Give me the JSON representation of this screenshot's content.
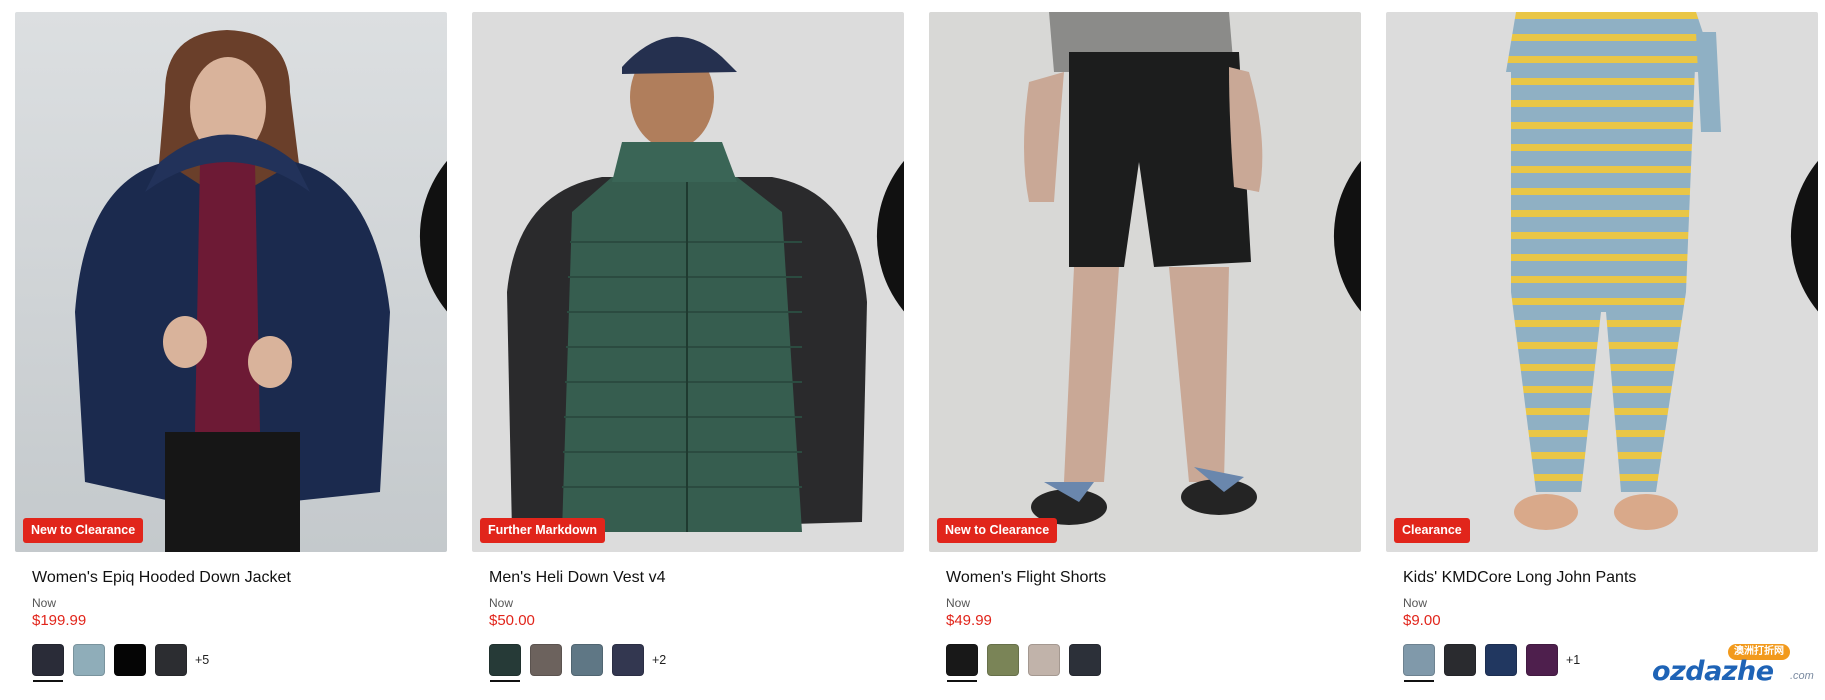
{
  "products": [
    {
      "title": "Women's Epiq Hooded Down Jacket",
      "badge": "New to Clearance",
      "now_label": "Now",
      "price": "$199.99",
      "swatches": [
        "#2a2c38",
        "#8fadb9",
        "#050505",
        "#2c2d31"
      ],
      "more": "+5",
      "wishlist_icon": "heart-outline-icon"
    },
    {
      "title": "Men's Heli Down Vest v4",
      "badge": "Further Markdown",
      "now_label": "Now",
      "price": "$50.00",
      "swatches": [
        "#263a37",
        "#6c625d",
        "#5f7785",
        "#333750"
      ],
      "more": "+2",
      "wishlist_icon": "heart-outline-icon"
    },
    {
      "title": "Women's Flight Shorts",
      "badge": "New to Clearance",
      "now_label": "Now",
      "price": "$49.99",
      "swatches": [
        "#181818",
        "#7a8457",
        "#c1b3aa",
        "#2c3039"
      ],
      "more": "",
      "wishlist_icon": "heart-outline-icon"
    },
    {
      "title": "Kids' KMDCore Long John Pants",
      "badge": "Clearance",
      "now_label": "Now",
      "price": "$9.00",
      "swatches": [
        "#8099aa",
        "#2a2b2f",
        "#213760",
        "#4e1f4d"
      ],
      "more": "+1",
      "wishlist_icon": "heart-outline-icon"
    }
  ],
  "watermark": {
    "text": "ozdazhe",
    "suffix": ".com",
    "tag": "澳洲打折网"
  },
  "colors": {
    "badge": "#e1251b",
    "price": "#e1251b"
  }
}
